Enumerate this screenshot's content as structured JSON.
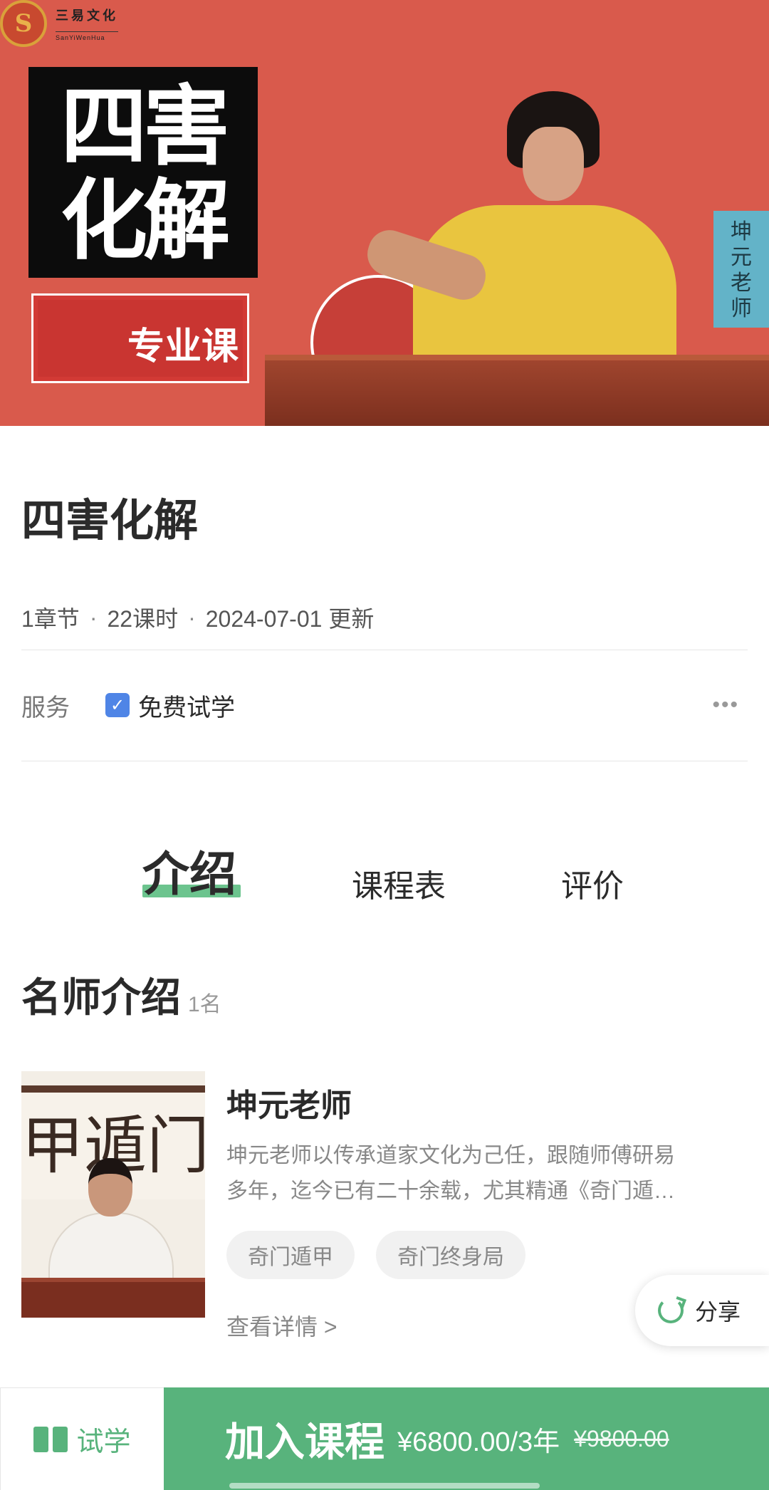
{
  "banner": {
    "logo_cn": "三易文化",
    "logo_en": "SanYiWenHua",
    "title_line1": "四害",
    "title_line2": "化解",
    "badge": "专业课",
    "teacher_tag": [
      "坤",
      "元",
      "老",
      "师"
    ]
  },
  "course": {
    "title": "四害化解",
    "chapters": "1章节",
    "lessons": "22课时",
    "updated": "2024-07-01 更新",
    "meta_sep": "·"
  },
  "service": {
    "label": "服务",
    "item": "免费试学",
    "more": "•••"
  },
  "tabs": [
    {
      "label": "介绍",
      "active": true
    },
    {
      "label": "课程表",
      "active": false
    },
    {
      "label": "评价",
      "active": false
    }
  ],
  "teachers_section": {
    "title": "名师介绍",
    "count": "1名"
  },
  "teacher": {
    "photo_wall_text": "甲遁门奇",
    "name": "坤元老师",
    "desc_line1": "坤元老师以传承道家文化为己任，跟随师傅研易",
    "desc_line2": "多年，迄今已有二十余载，尤其精通《奇门遁…",
    "tags": [
      "奇门遁甲",
      "奇门终身局"
    ],
    "detail_link": "查看详情 >"
  },
  "share": {
    "label": "分享"
  },
  "bottom_bar": {
    "trial_label": "试学",
    "join_label": "加入课程",
    "price": "¥6800.00/3年",
    "old_price": "¥9800.00"
  },
  "colors": {
    "banner_red": "#d95a4c",
    "accent_green": "#58b37c",
    "check_blue": "#4f85e6",
    "tab_underline": "#6cc48e"
  }
}
